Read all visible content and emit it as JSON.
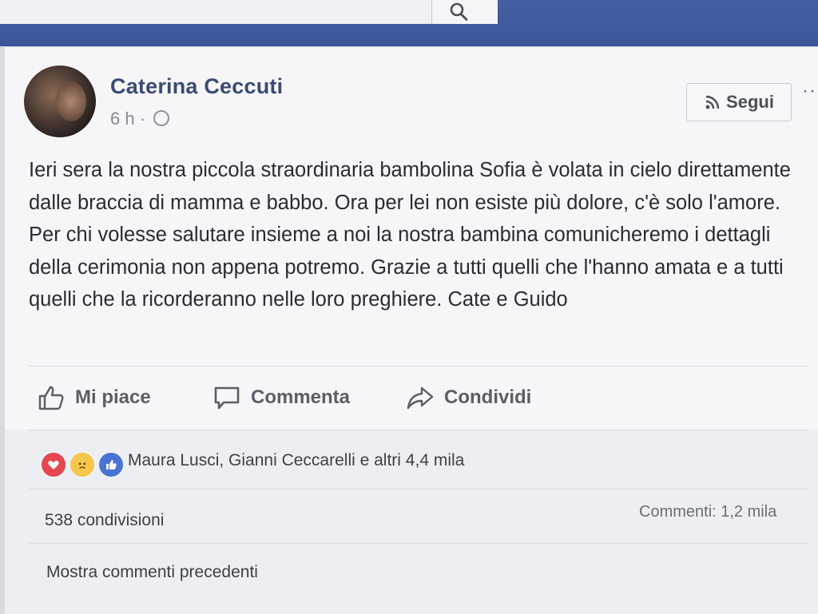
{
  "header": {
    "search_icon": "search-icon"
  },
  "post": {
    "author": "Caterina Ceccuti",
    "time": "6 h",
    "separator": "·",
    "privacy_icon": "globe-icon",
    "follow_label": "Segui",
    "follow_icon": "rss-icon",
    "more_label": "··",
    "text": "Ieri sera la nostra piccola straordinaria bambolina Sofia è volata in cielo direttamente dalle braccia di mamma e babbo. Ora per lei non esiste più dolore, c'è solo l'amore. Per chi volesse salutare insieme a noi la nostra bambina comunicheremo i dettagli della cerimonia non appena potremo. Grazie a tutti quelli che l'hanno amata e a tutti quelli che la ricorderanno nelle loro preghiere. Cate e Guido"
  },
  "actions": {
    "like_label": "Mi piace",
    "comment_label": "Commenta",
    "share_label": "Condividi"
  },
  "stats": {
    "reactions_text": "Maura Lusci, Gianni Ceccarelli e altri 4,4 mila",
    "reaction_icons": [
      "love-reaction-icon",
      "sad-reaction-icon",
      "like-reaction-icon"
    ],
    "shares_text": "538 condivisioni",
    "comments_text": "Commenti: 1,2 mila",
    "show_previous_comments": "Mostra commenti precedenti"
  },
  "colors": {
    "brand_blue": "#3b5998",
    "love_red": "#e5464f",
    "sad_yellow": "#f4c64c",
    "like_blue": "#4a74d4"
  }
}
